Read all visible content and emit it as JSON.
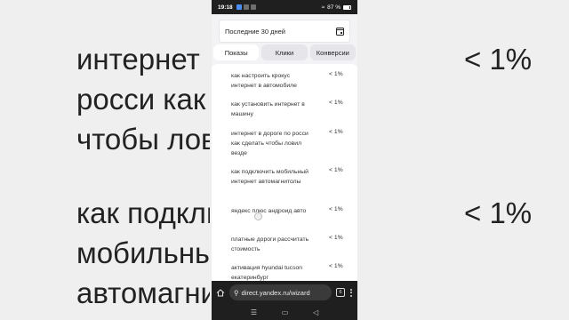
{
  "background": {
    "left_lines_1": [
      "интернет в д",
      "росси как сдела",
      "чтобы ловил"
    ],
    "left_lines_2": [
      "как подклю",
      "мобильный",
      "автомагнит"
    ],
    "right_1": "< 1%",
    "right_2": "< 1%"
  },
  "status_bar": {
    "time": "19:18",
    "battery": "87 %"
  },
  "date_filter": {
    "label": "Последние 30 дней"
  },
  "tabs": [
    {
      "label": "Показы",
      "active": true
    },
    {
      "label": "Клики",
      "active": false
    },
    {
      "label": "Конверсии",
      "active": false
    }
  ],
  "queries": [
    {
      "text": "как настроить крокус интернет в автомобиле",
      "value": "< 1%"
    },
    {
      "text": "как установить интернет в машину",
      "value": "< 1%"
    },
    {
      "text": "интернет в дороге по росси как сделать чтобы ловил везде",
      "value": "< 1%"
    },
    {
      "text": "как подключить мобильный интернет автомагнитолы",
      "value": "< 1%"
    },
    {
      "text": "яндекс плюс андроид авто",
      "value": "< 1%"
    },
    {
      "text": "платные дороги рассчитать стоимость",
      "value": "< 1%"
    },
    {
      "text": "активация hyundai tucson екатеринбург",
      "value": "< 1%"
    }
  ],
  "browser": {
    "url": "direct.yandex.ru/wizard",
    "tab_count": "6"
  }
}
